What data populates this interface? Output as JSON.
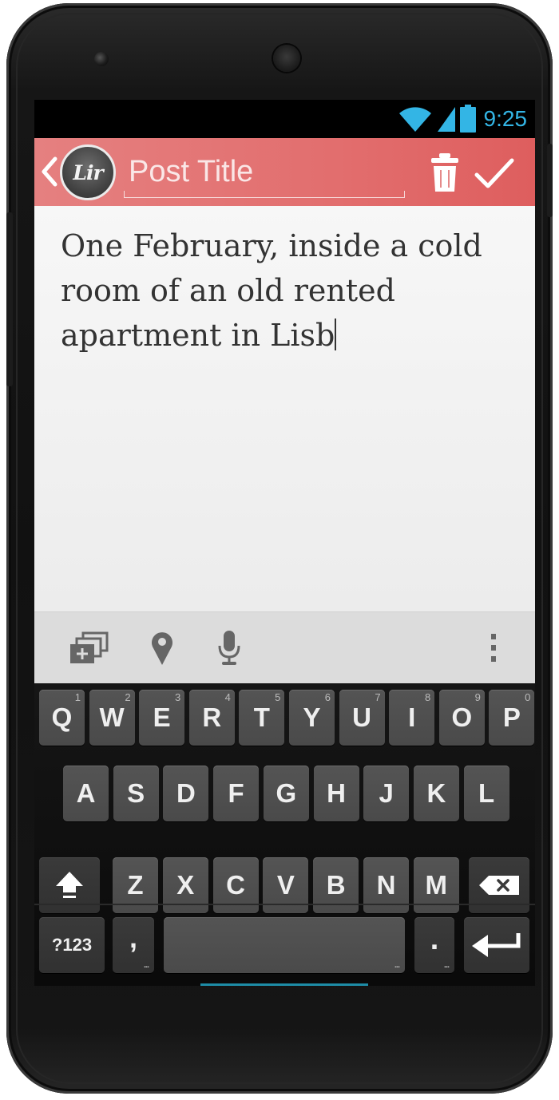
{
  "status_bar": {
    "time": "9:25",
    "icons": [
      "wifi-icon",
      "signal-icon",
      "battery-icon"
    ],
    "accent_color": "#33b5e5"
  },
  "action_bar": {
    "logo_text": "Lir",
    "title_placeholder": "Post Title",
    "title_value": "",
    "background_color": "#e26e6e",
    "actions": [
      "trash-icon",
      "checkmark-icon"
    ]
  },
  "editor": {
    "body_text": "One February, inside a cold room of an old rented apartment in Lisb"
  },
  "toolbar": {
    "tools": [
      "add-media-icon",
      "location-pin-icon",
      "microphone-icon",
      "overflow-menu-icon"
    ]
  },
  "keyboard": {
    "row1": [
      {
        "label": "Q",
        "hint": "1"
      },
      {
        "label": "W",
        "hint": "2"
      },
      {
        "label": "E",
        "hint": "3"
      },
      {
        "label": "R",
        "hint": "4"
      },
      {
        "label": "T",
        "hint": "5"
      },
      {
        "label": "Y",
        "hint": "6"
      },
      {
        "label": "U",
        "hint": "7"
      },
      {
        "label": "I",
        "hint": "8"
      },
      {
        "label": "O",
        "hint": "9"
      },
      {
        "label": "P",
        "hint": "0"
      }
    ],
    "row2": [
      "A",
      "S",
      "D",
      "F",
      "G",
      "H",
      "J",
      "K",
      "L"
    ],
    "row3": [
      "Z",
      "X",
      "C",
      "V",
      "B",
      "N",
      "M"
    ],
    "symbols_label": "?123",
    "comma_label": ",",
    "period_label": ".",
    "space_label": ""
  }
}
